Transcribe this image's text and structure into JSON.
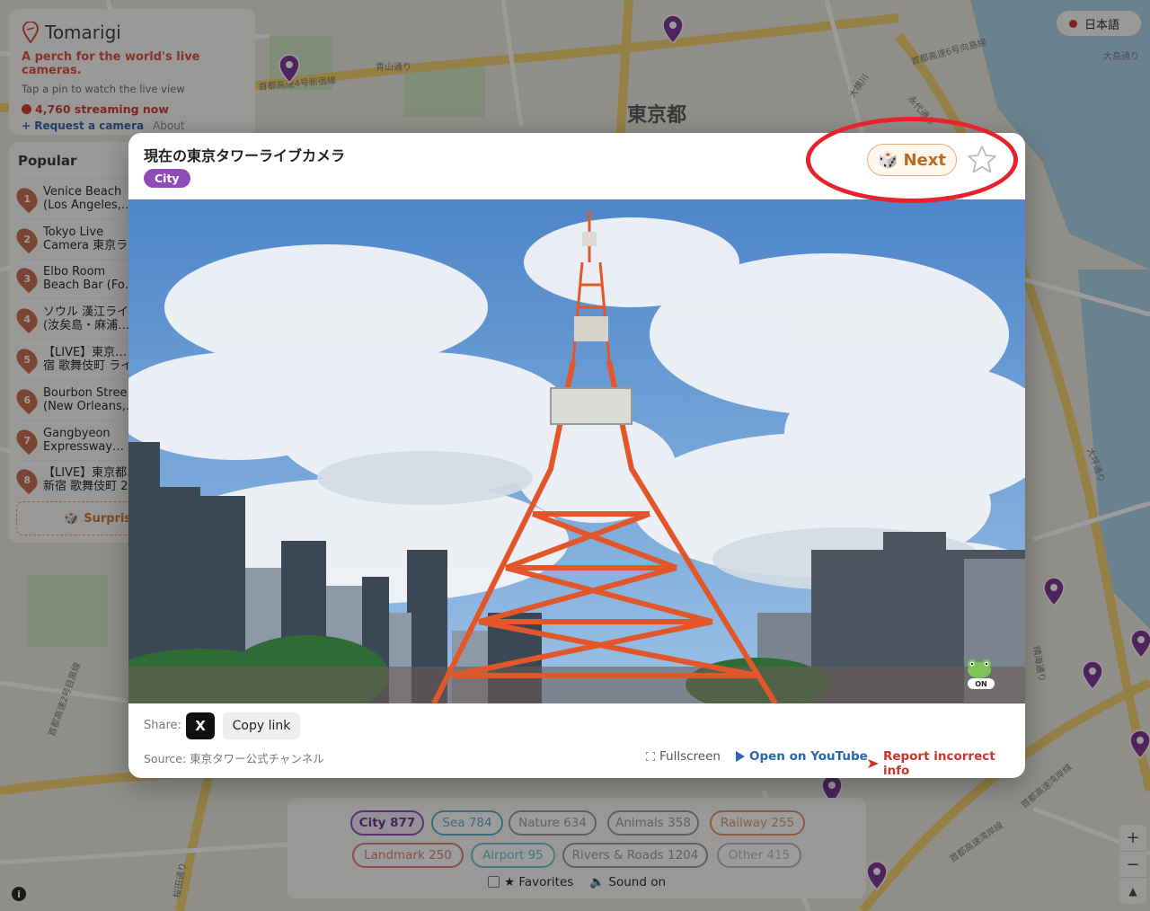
{
  "map": {
    "labels": [
      "東京都",
      "首都高速4号新宿線",
      "青山通り",
      "首都高速2号目黒線",
      "桜田通り",
      "首都高速湾岸線",
      "首都高速6号向島線",
      "大島通り",
      "永代通り",
      "大横川",
      "首都高速湾岸線",
      "晴海通り",
      "大坪通り"
    ]
  },
  "brand": {
    "name": "Tomarigi",
    "tagline": "A perch for the world's live cameras.",
    "hint": "Tap a pin to watch the live view",
    "streaming": "4,760 streaming now",
    "request": "+ Request a camera",
    "about": "About"
  },
  "language": {
    "label": "日本語"
  },
  "popular": {
    "title": "Popular",
    "items": [
      {
        "num": "1",
        "label": "Venice Beach\n(Los Angeles,…"
      },
      {
        "num": "2",
        "label": "Tokyo Live\nCamera 東京ラ…"
      },
      {
        "num": "3",
        "label": "Elbo Room\nBeach Bar (Fo…"
      },
      {
        "num": "4",
        "label": "ソウル 漢江ライ…\n(汝矣島・麻浦…"
      },
      {
        "num": "5",
        "label": "【LIVE】東京…\n宿 歌舞伎町 ライ…"
      },
      {
        "num": "6",
        "label": "Bourbon Stree…\n(New Orleans,…"
      },
      {
        "num": "7",
        "label": "Gangbyeon\nExpressway…"
      },
      {
        "num": "8",
        "label": "【LIVE】東京都…\n新宿 歌舞伎町 2…"
      }
    ],
    "surprise": "Surprise"
  },
  "filters": {
    "chips": [
      {
        "label": "City 877",
        "color": "#8e4bb5",
        "active": true
      },
      {
        "label": "Sea 784",
        "color": "#5aaecf",
        "active": false
      },
      {
        "label": "Nature 634",
        "color": "#9a9a9a",
        "active": false
      },
      {
        "label": "Animals 358",
        "color": "#9a9a9a",
        "active": false
      },
      {
        "label": "Railway 255",
        "color": "#e0956a",
        "active": false
      },
      {
        "label": "Landmark 250",
        "color": "#e07a7a",
        "active": false
      },
      {
        "label": "Airport 95",
        "color": "#6fc3c7",
        "active": false
      },
      {
        "label": "Rivers & Roads 1204",
        "color": "#9a9a9a",
        "active": false
      },
      {
        "label": "Other 415",
        "color": "#b8b8b8",
        "active": false
      }
    ],
    "favorites": "★ Favorites",
    "sound": "Sound on"
  },
  "modal": {
    "title": "現在の東京タワーライブカメラ",
    "category": "City",
    "next_label": "Next",
    "share_label": "Share:",
    "x_label": "X",
    "copy_label": "Copy link",
    "source": "Source: 東京タワー公式チャンネル",
    "fullscreen": "Fullscreen",
    "youtube": "Open on YouTube",
    "report": "Report incorrect info",
    "frog_status": "ON"
  },
  "zoom": {
    "in": "+",
    "out": "−",
    "compass": "▲"
  },
  "colors": {
    "accent_purple": "#8e4bb5",
    "next_orange": "#b96a23",
    "annotation_red": "#e8222c"
  }
}
